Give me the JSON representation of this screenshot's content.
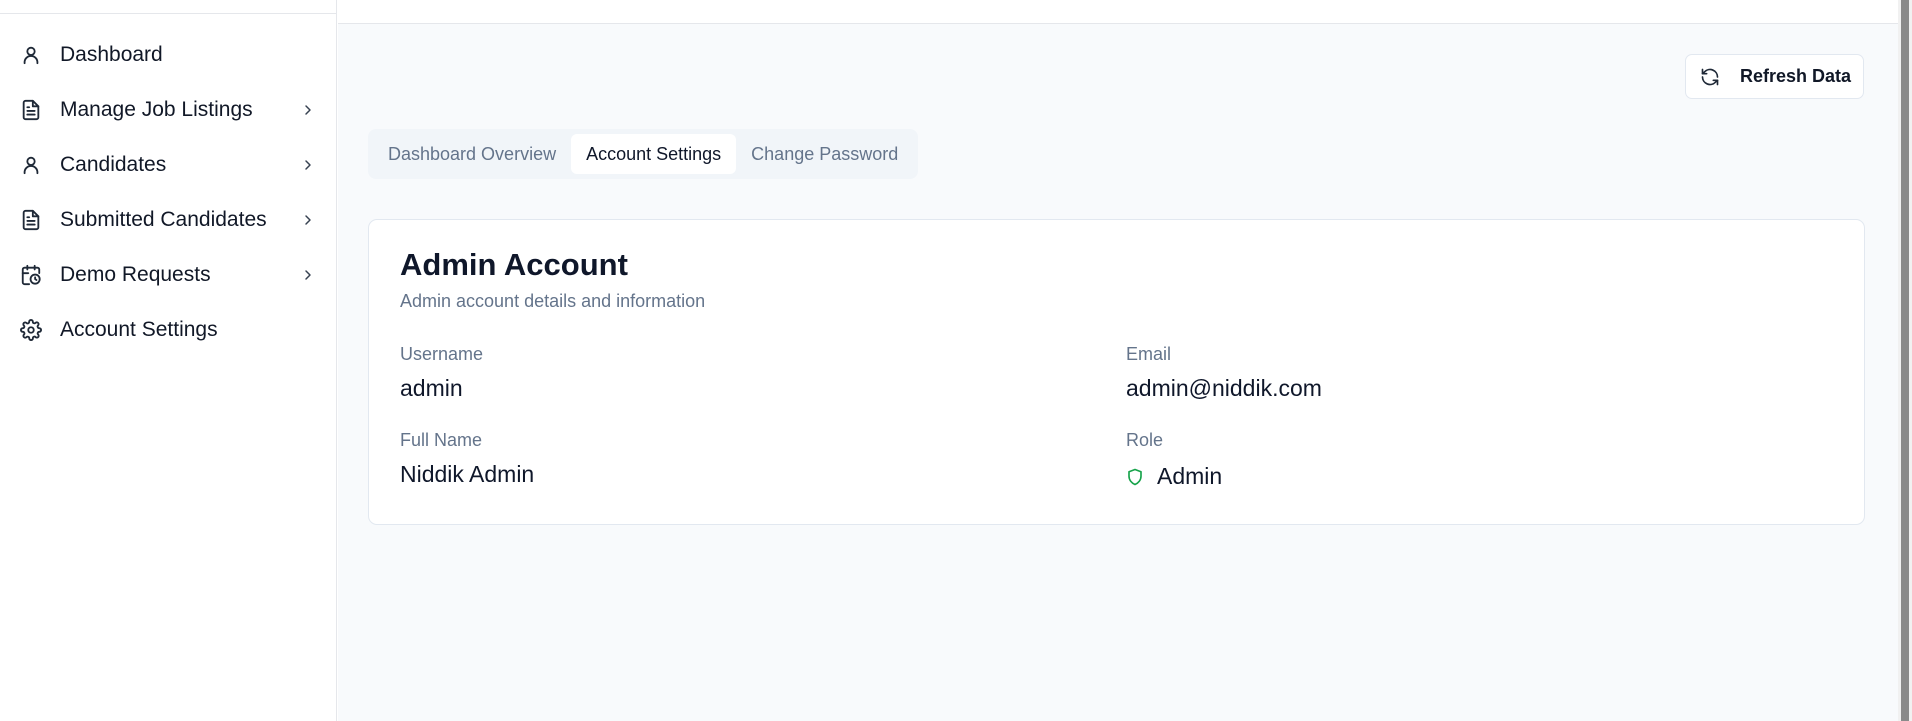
{
  "sidebar": {
    "items": [
      {
        "label": "Dashboard",
        "icon": "user-icon",
        "has_submenu": false
      },
      {
        "label": "Manage Job Listings",
        "icon": "file-text-icon",
        "has_submenu": true
      },
      {
        "label": "Candidates",
        "icon": "user-icon",
        "has_submenu": true
      },
      {
        "label": "Submitted Candidates",
        "icon": "file-text-icon",
        "has_submenu": true
      },
      {
        "label": "Demo Requests",
        "icon": "calendar-clock-icon",
        "has_submenu": true
      },
      {
        "label": "Account Settings",
        "icon": "gear-icon",
        "has_submenu": false
      }
    ]
  },
  "toolbar": {
    "refresh_label": "Refresh Data",
    "refresh_icon": "refresh-icon"
  },
  "tabs": [
    {
      "label": "Dashboard Overview",
      "active": false
    },
    {
      "label": "Account Settings",
      "active": true
    },
    {
      "label": "Change Password",
      "active": false
    }
  ],
  "account_card": {
    "title": "Admin Account",
    "subtitle": "Admin account details and information",
    "fields": {
      "username": {
        "label": "Username",
        "value": "admin"
      },
      "email": {
        "label": "Email",
        "value": "admin@niddik.com"
      },
      "full_name": {
        "label": "Full Name",
        "value": "Niddik Admin"
      },
      "role": {
        "label": "Role",
        "value": "Admin",
        "icon": "shield-icon"
      }
    }
  },
  "colors": {
    "accent_green": "#16a34a",
    "muted_text": "#64748b",
    "main_bg": "#f8fafc"
  }
}
